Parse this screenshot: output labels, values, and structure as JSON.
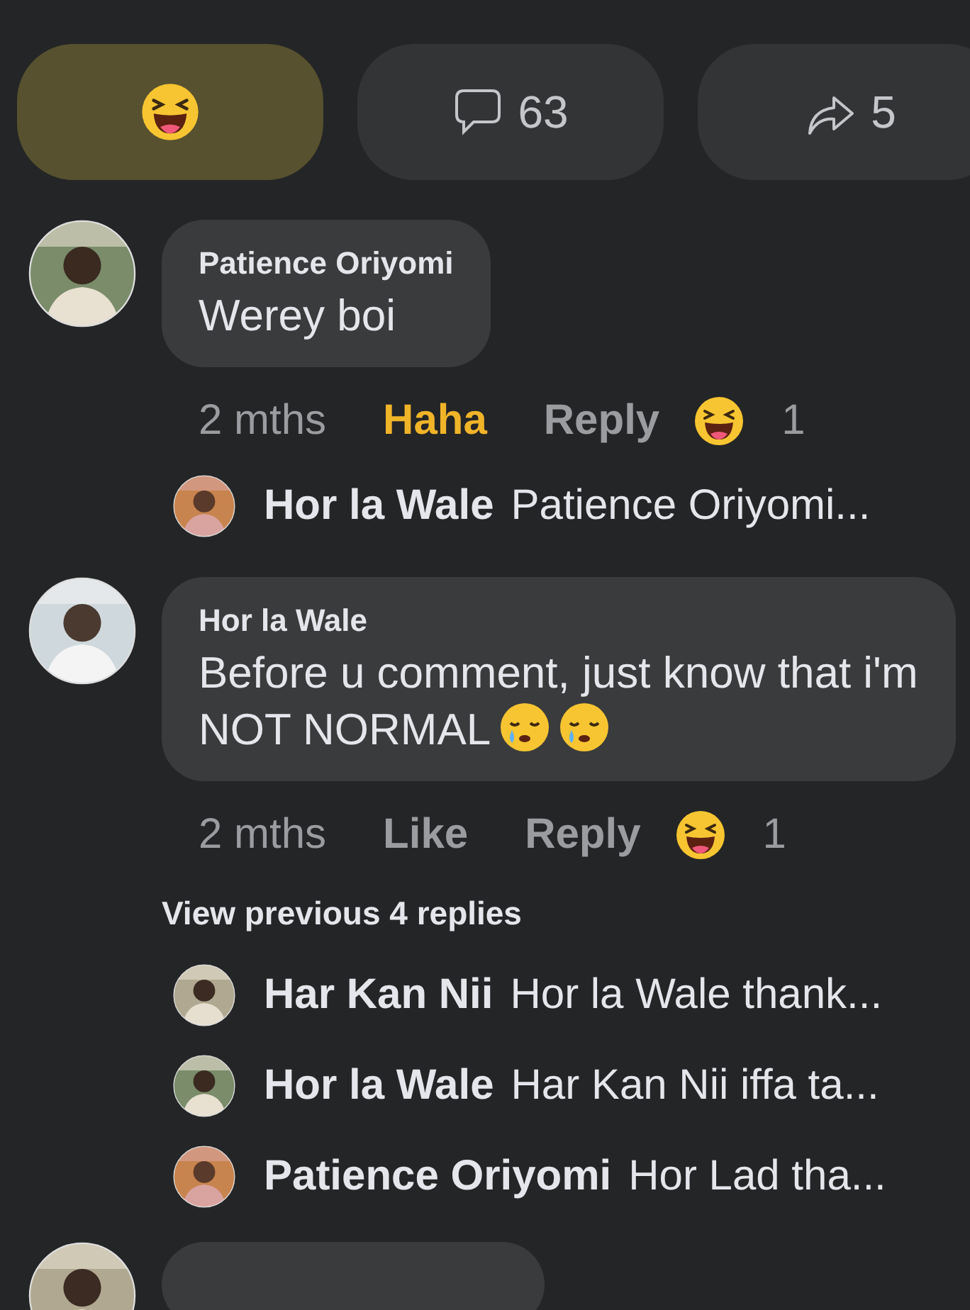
{
  "actions": [
    {
      "kind": "reaction",
      "selected": true
    },
    {
      "kind": "comment",
      "count": "63"
    },
    {
      "kind": "share",
      "count": "5"
    }
  ],
  "comments": [
    {
      "author": "Patience Oriyomi",
      "text": "Werey boi",
      "time": "2 mths",
      "react_label": "Haha",
      "reacted": true,
      "reply_label": "Reply",
      "reaction_count": "1",
      "replies": [
        {
          "author": "Hor la Wale",
          "text": "Patience Oriyomi..."
        }
      ]
    },
    {
      "author": "Hor la Wale",
      "text": "Before u comment, just know that i'm NOT NORMAL",
      "emojis": [
        {
          "kind": "sleepy"
        },
        {
          "kind": "sleepy"
        }
      ],
      "time": "2 mths",
      "react_label": "Like",
      "reacted": false,
      "reply_label": "Reply",
      "reaction_count": "1",
      "view_previous": "View previous 4 replies",
      "replies": [
        {
          "author": "Har Kan Nii",
          "text": "Hor la Wale thank..."
        },
        {
          "author": "Hor la Wale",
          "text": "Har Kan Nii iffa ta..."
        },
        {
          "author": "Patience Oriyomi",
          "text": "Hor Lad tha..."
        }
      ]
    }
  ]
}
